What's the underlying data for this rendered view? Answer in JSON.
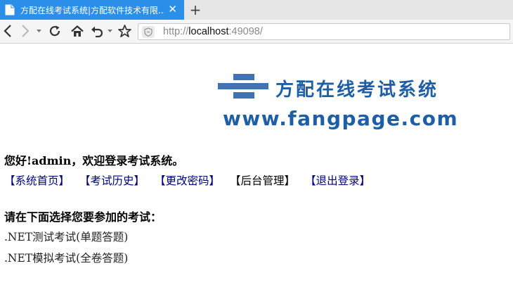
{
  "browser": {
    "tab_title": "方配在线考试系统|方配软件技术有限...",
    "tab_close": "✕",
    "new_tab": "+",
    "url_scheme": "http://",
    "url_host": "localhost",
    "url_port": ":49098/"
  },
  "logo": {
    "title": "方配在线考试系统",
    "url": "www.fangpage.com"
  },
  "page": {
    "greeting": "您好!admin，欢迎登录考试系统。",
    "menu": [
      "【系统首页】",
      "【考试历史】",
      "【更改密码】",
      "【后台管理】",
      "【退出登录】"
    ],
    "prompt": "请在下面选择您要参加的考试：",
    "exams": [
      ".NET测试考试(单题答题)",
      ".NET模拟考试(全卷答题)"
    ]
  },
  "colors": {
    "tab_active": "#2b8ee8",
    "logo_blue": "#1d5ea6",
    "link": "#000080"
  }
}
